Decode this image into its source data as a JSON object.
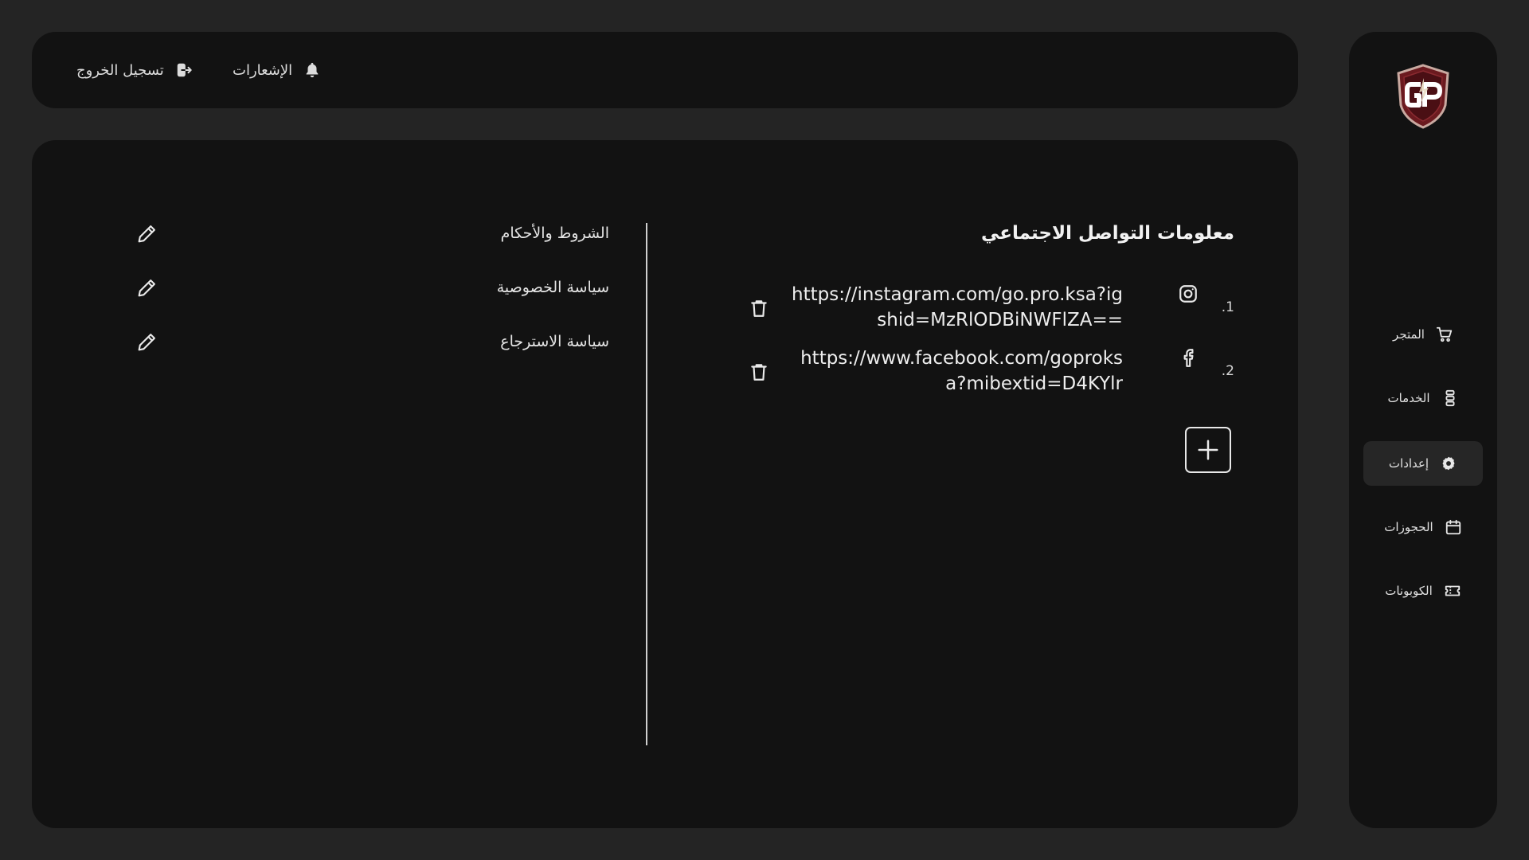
{
  "sidebar": {
    "items": [
      {
        "label": "المتجر",
        "icon": "cart-icon",
        "active": false
      },
      {
        "label": "الخدمات",
        "icon": "server-icon",
        "active": false
      },
      {
        "label": "إعدادات",
        "icon": "gear-icon",
        "active": true
      },
      {
        "label": "الحجوزات",
        "icon": "calendar-icon",
        "active": false
      },
      {
        "label": "الكوبونات",
        "icon": "ticket-icon",
        "active": false
      }
    ]
  },
  "header": {
    "notifications_label": "الإشعارات",
    "logout_label": "تسجيل الخروج"
  },
  "social": {
    "title": "معلومات التواصل الاجتماعي",
    "links": [
      {
        "number": ".1",
        "icon": "instagram-icon",
        "url": "https://instagram.com/go.pro.ksa?igshid=MzRlODBiNWFlZA=="
      },
      {
        "number": ".2",
        "icon": "facebook-icon",
        "url": "https://www.facebook.com/goproksa?mibextid=D4KYlr"
      }
    ]
  },
  "policies": [
    {
      "label": "الشروط والأحكام"
    },
    {
      "label": "سياسة الخصوصية"
    },
    {
      "label": "سياسة الاسترجاع"
    }
  ],
  "colors": {
    "background": "#242424",
    "panel": "#121212",
    "active_item": "#262626",
    "logo_maroon": "#6b1a1f"
  }
}
